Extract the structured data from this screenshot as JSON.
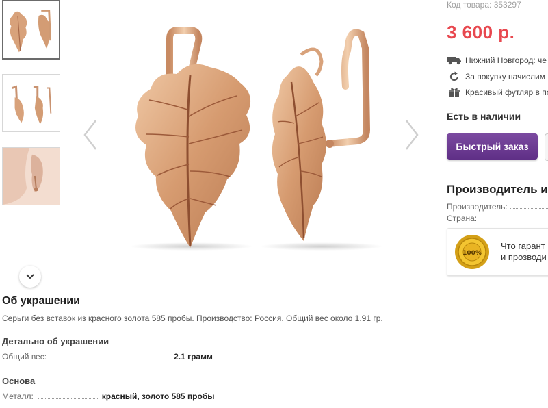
{
  "gallery": {
    "thumbnails": [
      "earrings-front",
      "earrings-side",
      "earring-on-ear"
    ]
  },
  "product": {
    "code": "Код товара: 353297",
    "price": "3 600 р.",
    "delivery": "Нижний Новгород: че",
    "bonus": "За покупку начислим",
    "gift": "Красивый футляр в по",
    "stock": "Есть в наличии",
    "quick_order": "Быстрый заказ"
  },
  "maker": {
    "title": "Производитель и п",
    "manufacturer_label": "Производитель:",
    "country_label": "Страна:",
    "guarantee_text_1": "Что гарант",
    "guarantee_text_2": "и прозводи"
  },
  "about": {
    "title": "Об украшении",
    "text": "Серьги без вставок из красного золота 585 пробы. Производство: Россия. Общий вес около 1.91 гр.",
    "details_title": "Детально об украшении",
    "weight_label": "Общий вес:",
    "weight_value": "2.1 грамм",
    "base_title": "Основа",
    "metal_label": "Металл:",
    "metal_value": "красный, золото 585 пробы"
  },
  "colors": {
    "price": "#e8484f",
    "button": "#6a3a8f",
    "gold": "#d9a37a"
  }
}
